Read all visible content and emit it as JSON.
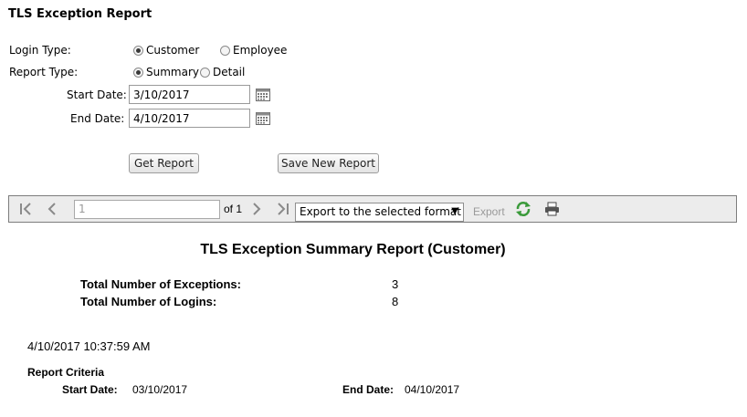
{
  "header": {
    "title": "TLS Exception Report"
  },
  "form": {
    "login_type": {
      "label": "Login Type:",
      "options": [
        "Customer",
        "Employee"
      ],
      "selected": "Customer"
    },
    "report_type": {
      "label": "Report Type:",
      "options": [
        "Summary",
        "Detail"
      ],
      "selected": "Summary"
    },
    "start_date": {
      "label": "Start Date:",
      "value": "3/10/2017"
    },
    "end_date": {
      "label": "End Date:",
      "value": "4/10/2017"
    },
    "get_report_label": "Get Report",
    "save_report_label": "Save New Report"
  },
  "toolbar": {
    "page_value": "1",
    "of_label": "of 1",
    "export_format": "Export to the selected format",
    "export_label": "Export"
  },
  "report": {
    "title": "TLS Exception Summary Report (Customer)",
    "exceptions_label": "Total Number of Exceptions:",
    "exceptions_value": "3",
    "logins_label": "Total Number of Logins:",
    "logins_value": "8",
    "timestamp": "4/10/2017 10:37:59 AM",
    "criteria_label": "Report Criteria",
    "start_label": "Start Date:",
    "start_value": "03/10/2017",
    "end_label": "End Date:",
    "end_value": "04/10/2017"
  }
}
